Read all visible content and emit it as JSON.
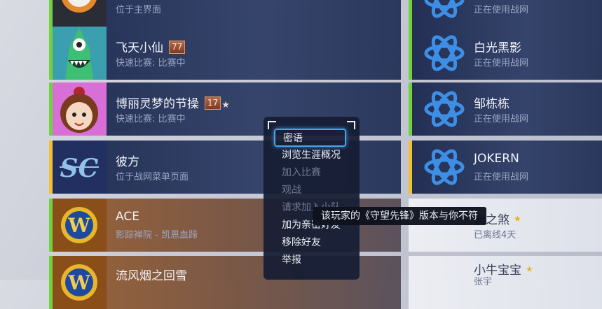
{
  "left_friends": [
    {
      "name": "",
      "level": "",
      "star": false,
      "status": "位于主界面",
      "bar_color": "#6fd33c",
      "avatar": "skull-portrait"
    },
    {
      "name": "飞天小仙",
      "level": "77",
      "star": false,
      "status": "快速比赛: 比赛中",
      "bar_color": "#6fd33c",
      "avatar": "green-monster-portrait"
    },
    {
      "name": "博丽灵梦的节操",
      "level": "17",
      "star": true,
      "status": "快速比赛: 比赛中",
      "bar_color": "#6fd33c",
      "avatar": "girl-portrait"
    },
    {
      "name": "彼方",
      "level": "",
      "star": false,
      "status": "位于战网菜单页面",
      "bar_color": "#f2c12e",
      "avatar": "starcraft-logo"
    },
    {
      "name": "ACE",
      "level": "",
      "star": false,
      "status": "影踪禅院 - 凯恩血蹄",
      "bar_color": "#6fd33c",
      "avatar": "warcraft-logo"
    },
    {
      "name": "流风烟之回雪",
      "level": "",
      "star": false,
      "status": "",
      "bar_color": "#6fd33c",
      "avatar": "warcraft-logo"
    }
  ],
  "right_friends": [
    {
      "name": "",
      "status": "正在使用战网",
      "bar_color": "#6fd33c",
      "gold_star": false
    },
    {
      "name": "白光黑影",
      "status": "正在使用战网",
      "bar_color": "#6fd33c",
      "gold_star": false
    },
    {
      "name": "邹栋栋",
      "status": "正在使用战网",
      "bar_color": "#6fd33c",
      "gold_star": false
    },
    {
      "name": "JOKERN",
      "status": "正在使用战网",
      "bar_color": "#f2c12e",
      "gold_star": false
    },
    {
      "name": "衰之煞",
      "status": "已离线4天",
      "bar_color": "",
      "gold_star": true
    },
    {
      "name": "小牛宝宝",
      "status": "张宇",
      "bar_color": "",
      "gold_star": true
    }
  ],
  "context_menu": {
    "items": [
      {
        "label": "密语",
        "enabled": true,
        "focused": true
      },
      {
        "label": "浏览生涯概况",
        "enabled": true,
        "focused": false
      },
      {
        "label": "加入比赛",
        "enabled": false,
        "focused": false
      },
      {
        "label": "观战",
        "enabled": false,
        "focused": false
      },
      {
        "label": "请求加入小队",
        "enabled": false,
        "focused": false
      },
      {
        "label": "加为亲密好友",
        "enabled": true,
        "focused": false
      },
      {
        "label": "移除好友",
        "enabled": true,
        "focused": false
      },
      {
        "label": "举报",
        "enabled": true,
        "focused": false
      }
    ]
  },
  "tooltip": {
    "text": "该玩家的《守望先锋》版本与你不符"
  },
  "colors": {
    "accent": "#4aa3e6",
    "online": "#6fd33c",
    "away": "#f2c12e",
    "row_bg": "#1c284e"
  }
}
